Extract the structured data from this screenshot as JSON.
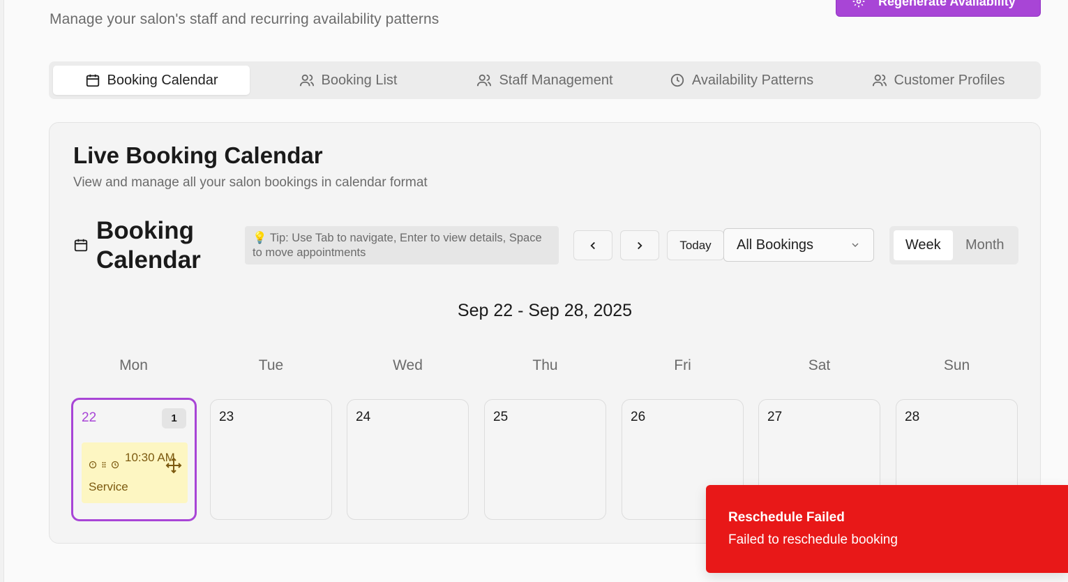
{
  "header": {
    "subtitle": "Manage your salon's staff and recurring availability patterns",
    "regen_label": "Regenerate Availability",
    "regen_icon": "sparkle-cog-icon",
    "accent": "#a845d6"
  },
  "tabs": [
    {
      "label": "Booking Calendar",
      "icon": "calendar-icon",
      "active": true
    },
    {
      "label": "Booking List",
      "icon": "users-icon",
      "active": false
    },
    {
      "label": "Staff Management",
      "icon": "users-icon",
      "active": false
    },
    {
      "label": "Availability Patterns",
      "icon": "clock-icon",
      "active": false
    },
    {
      "label": "Customer Profiles",
      "icon": "users-icon",
      "active": false
    }
  ],
  "card": {
    "title": "Live Booking Calendar",
    "description": "View and manage all your salon bookings in calendar format"
  },
  "calendar": {
    "title": "Booking Calendar",
    "tip": "💡 Tip: Use Tab to navigate, Enter to view details, Space to move appointments",
    "today_label": "Today",
    "filter_value": "All Bookings",
    "views": [
      "Week",
      "Month"
    ],
    "active_view": "Week",
    "range": "Sep 22 - Sep 28, 2025",
    "weekdays": [
      "Mon",
      "Tue",
      "Wed",
      "Thu",
      "Fri",
      "Sat",
      "Sun"
    ],
    "days": [
      {
        "num": "22",
        "today": true,
        "count": "1",
        "appointment": {
          "time": "10:30 AM",
          "service": "Service",
          "color": "#fdf6c2"
        }
      },
      {
        "num": "23"
      },
      {
        "num": "24"
      },
      {
        "num": "25"
      },
      {
        "num": "26"
      },
      {
        "num": "27"
      },
      {
        "num": "28"
      }
    ]
  },
  "toast": {
    "title": "Reschedule Failed",
    "message": "Failed to reschedule booking",
    "color": "#e81818"
  }
}
